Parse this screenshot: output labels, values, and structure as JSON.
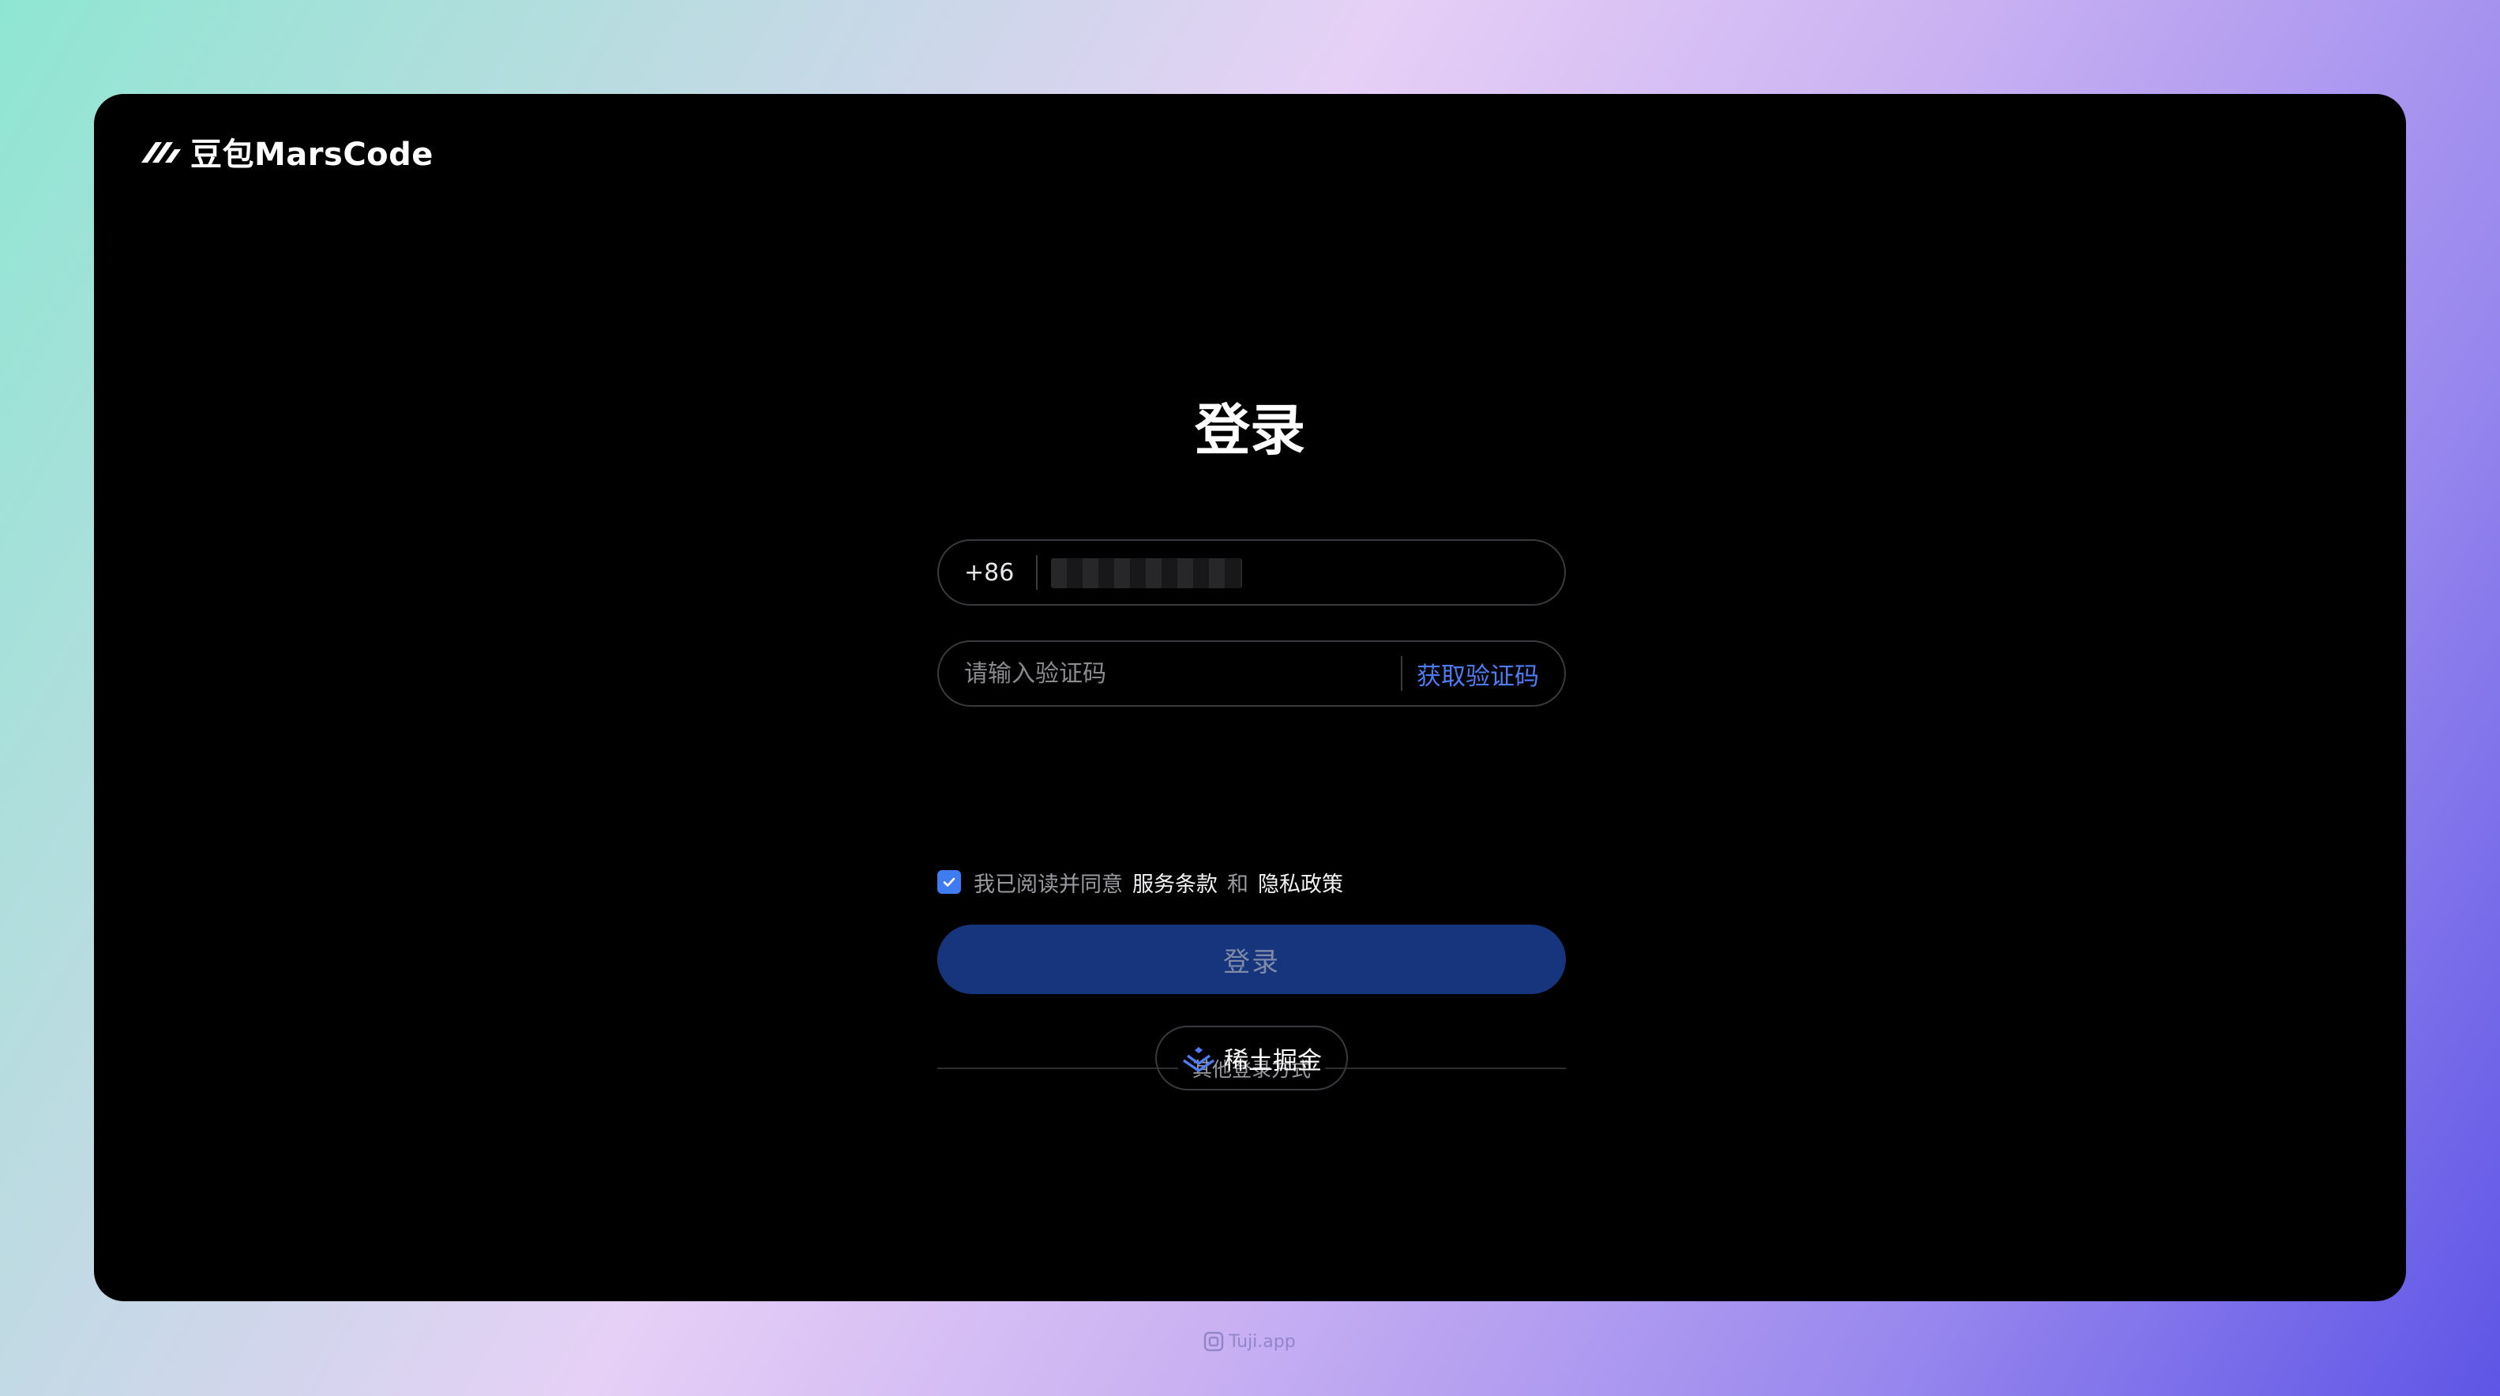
{
  "brand": {
    "name": "豆包MarsCode",
    "logo_icon": "marscode-logo-icon"
  },
  "login": {
    "title": "登录",
    "phone": {
      "country_code": "+86",
      "value_masked": true
    },
    "code": {
      "placeholder": "请输入验证码",
      "get_code_label": "获取验证码"
    },
    "agreement": {
      "checked": true,
      "prefix": "我已阅读并同意",
      "terms_label": "服务条款",
      "and": "和",
      "privacy_label": "隐私政策"
    },
    "submit_label": "登录",
    "other_methods_label": "其他登录方式",
    "juejin_label": "稀土掘金",
    "juejin_icon": "juejin-icon"
  },
  "watermark": "Tuji.app",
  "colors": {
    "accent": "#3f7cf2",
    "link": "#4d7cf5",
    "button_bg": "#16357c",
    "frame_bg": "#000000"
  }
}
